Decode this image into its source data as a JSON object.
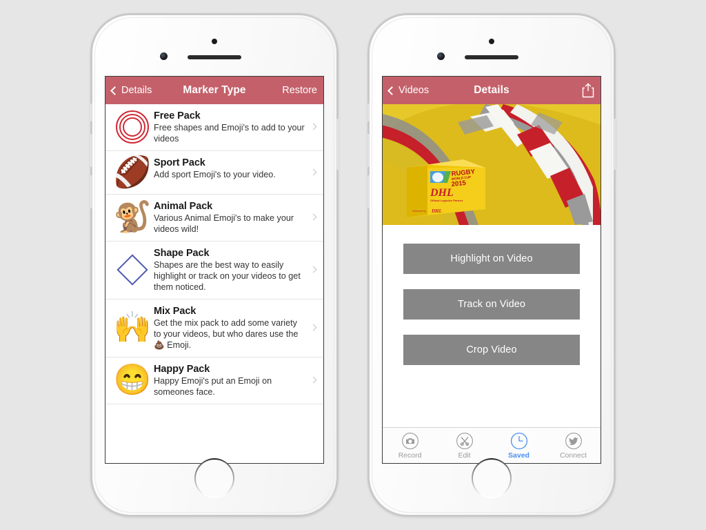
{
  "background_color": "#e6e6e6",
  "accent_color": "#c4606a",
  "left_phone": {
    "name": "marker-type-screen",
    "navbar": {
      "back_label": "Details",
      "title": "Marker Type",
      "right_label": "Restore"
    },
    "packs": [
      {
        "title": "Free Pack",
        "subtitle": "Free shapes and Emoji's to add to your videos",
        "icon": "concentric-rings-icon",
        "icon_glyph": ""
      },
      {
        "title": "Sport Pack",
        "subtitle": "Add sport Emoji's to your video.",
        "icon": "football-emoji-icon",
        "icon_glyph": "🏈"
      },
      {
        "title": "Animal Pack",
        "subtitle": "Various Animal Emoji's to make your videos wild!",
        "icon": "monkey-emoji-icon",
        "icon_glyph": "🐒"
      },
      {
        "title": "Shape Pack",
        "subtitle": "Shapes are the best way to easily highlight or track on your videos to get them noticed.",
        "icon": "diamond-shape-icon",
        "icon_glyph": ""
      },
      {
        "title": "Mix Pack",
        "subtitle": "Get the mix pack to add some variety to your videos, but who dares use the 💩 Emoji.",
        "icon": "raising-hands-emoji-icon",
        "icon_glyph": "🙌"
      },
      {
        "title": "Happy Pack",
        "subtitle": "Happy Emoji's put an Emoji on someones face.",
        "icon": "grinning-face-emoji-icon",
        "icon_glyph": "😁"
      }
    ]
  },
  "right_phone": {
    "name": "video-details-screen",
    "navbar": {
      "back_label": "Videos",
      "title": "Details",
      "share_icon": "share-icon"
    },
    "hero": {
      "description": "Rugby World Cup 2015 DHL box on yellow background with ribbons",
      "box_text_line1": "RUGBY",
      "box_text_line2": "WORLD CUP",
      "box_text_line3": "2015",
      "box_brand": "DHL",
      "box_tagline": "Official Logistics Partner",
      "box_footer": "Delivered by  DHL"
    },
    "actions": [
      {
        "label": "Highlight on Video",
        "name": "highlight-on-video-button"
      },
      {
        "label": "Track on Video",
        "name": "track-on-video-button"
      },
      {
        "label": "Crop Video",
        "name": "crop-video-button"
      }
    ],
    "tabs": [
      {
        "label": "Record",
        "icon": "camera-icon",
        "active": false
      },
      {
        "label": "Edit",
        "icon": "scissors-icon",
        "active": false
      },
      {
        "label": "Saved",
        "icon": "clock-icon",
        "active": true
      },
      {
        "label": "Connect",
        "icon": "twitter-icon",
        "active": false
      }
    ]
  }
}
